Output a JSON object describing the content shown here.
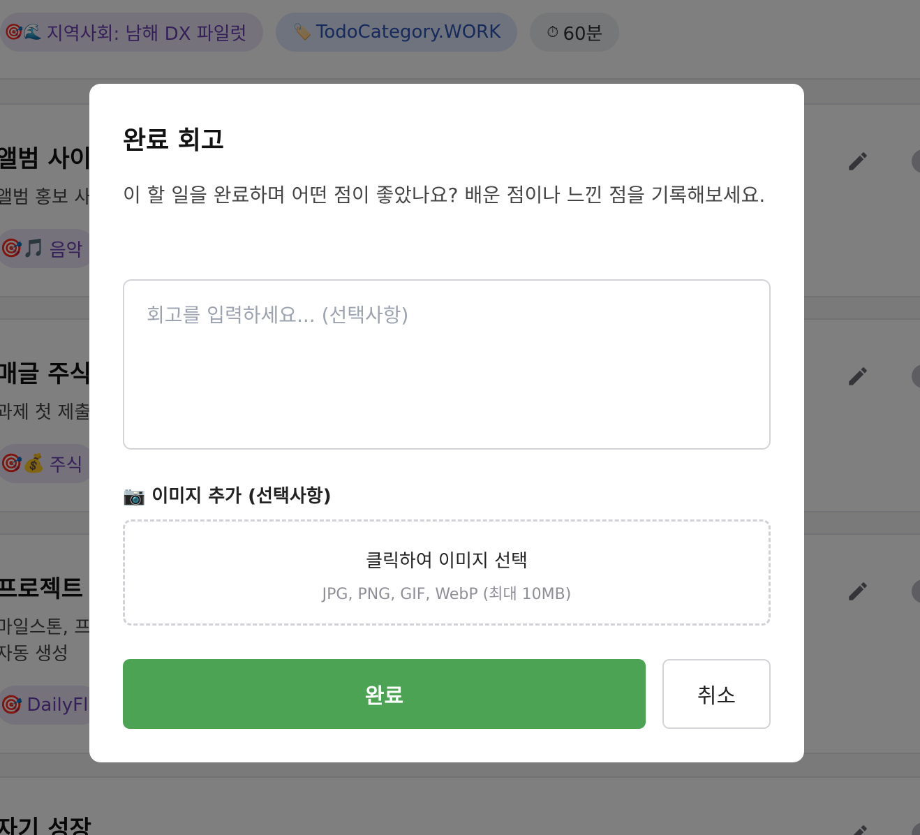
{
  "background": {
    "top_chips": {
      "goal": {
        "icons": "🎯🌊",
        "label": "지역사회: 남해 DX 파일럿"
      },
      "category": {
        "icon": "🏷️",
        "label": "TodoCategory.WORK"
      },
      "duration": {
        "icon": "⏱",
        "label": "60분"
      }
    },
    "cards": [
      {
        "title": "앨범 사이트",
        "desc": "앨범 홍보 사이",
        "chip_icons": "🎯🎵",
        "chip_label": "음악"
      },
      {
        "title": "매글 주식",
        "desc": "과제 첫 제출",
        "chip_icons": "🎯💰",
        "chip_label": "주식"
      },
      {
        "title": "프로젝트 관",
        "desc": "마일스톤, 프",
        "desc2": "자동 생성",
        "chip_icons": "🎯",
        "chip_label": "DailyFl"
      },
      {
        "title": "자기 성장"
      }
    ]
  },
  "modal": {
    "title": "완료 회고",
    "description": "이 할 일을 완료하며 어떤 점이 좋았나요? 배운 점이나 느낀 점을 기록해보세요.",
    "retrospective": {
      "value": "",
      "placeholder": "회고를 입력하세요... (선택사항)"
    },
    "image": {
      "label": "📷 이미지 추가 (선택사항)",
      "upload_main": "클릭하여 이미지 선택",
      "upload_sub": "JPG, PNG, GIF, WebP (최대 10MB)"
    },
    "buttons": {
      "complete": "완료",
      "cancel": "취소"
    }
  },
  "colors": {
    "complete_button": "#4da354",
    "goal_chip_bg": "#ede4f7",
    "goal_chip_text": "#6b3fb0",
    "category_chip_bg": "#dfe7fb",
    "category_chip_text": "#2d55b6"
  }
}
